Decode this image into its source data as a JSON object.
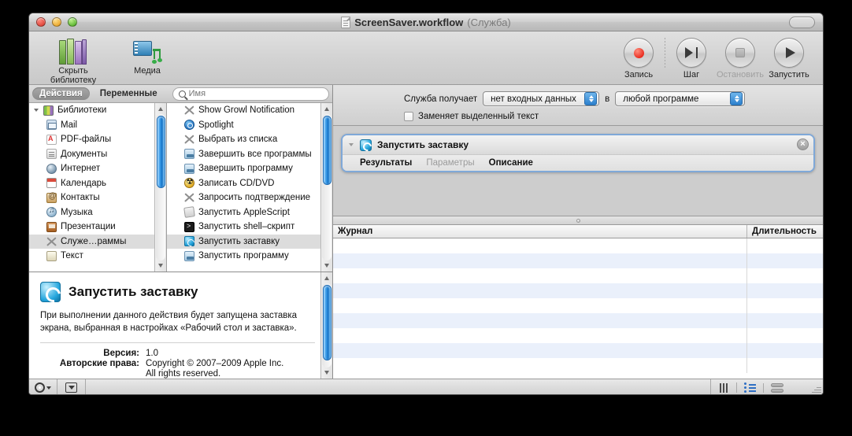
{
  "window": {
    "title": "ScreenSaver.workflow",
    "title_suffix": "(Служба)",
    "doc_icon": "document-icon",
    "toolbar_toggle": "toolbar-toggle-pill"
  },
  "toolbar": {
    "items": [
      {
        "label": "Скрыть библиотеку",
        "icon": "library-books-icon"
      },
      {
        "label": "Медиа",
        "icon": "media-icon"
      }
    ],
    "controls": [
      {
        "label": "Запись",
        "icon": "record-dot-icon",
        "enabled": true
      },
      {
        "label": "Шаг",
        "icon": "step-icon",
        "enabled": true
      },
      {
        "label": "Остановить",
        "icon": "stop-square-icon",
        "enabled": false
      },
      {
        "label": "Запустить",
        "icon": "play-triangle-icon",
        "enabled": true
      }
    ]
  },
  "library": {
    "tabs": [
      {
        "label": "Действия",
        "selected": true
      },
      {
        "label": "Переменные",
        "selected": false
      }
    ],
    "search": {
      "placeholder": "Имя",
      "value": ""
    },
    "tree": [
      {
        "label": "Библиотеки",
        "icon": "libraries-icon",
        "root": true,
        "selected": false
      },
      {
        "label": "Mail",
        "icon": "mail-icon",
        "root": false,
        "selected": false
      },
      {
        "label": "PDF-файлы",
        "icon": "pdf-icon",
        "root": false,
        "selected": false
      },
      {
        "label": "Документы",
        "icon": "documents-icon",
        "root": false,
        "selected": false
      },
      {
        "label": "Интернет",
        "icon": "internet-icon",
        "root": false,
        "selected": false
      },
      {
        "label": "Календарь",
        "icon": "calendar-icon",
        "root": false,
        "selected": false
      },
      {
        "label": "Контакты",
        "icon": "contacts-icon",
        "root": false,
        "selected": false
      },
      {
        "label": "Музыка",
        "icon": "music-icon",
        "root": false,
        "selected": false
      },
      {
        "label": "Презентации",
        "icon": "presentations-icon",
        "root": false,
        "selected": false
      },
      {
        "label": "Служе…раммы",
        "icon": "utilities-icon",
        "root": false,
        "selected": true
      },
      {
        "label": "Текст",
        "icon": "text-icon",
        "root": false,
        "selected": false
      }
    ],
    "actions": [
      {
        "label": "Show Growl Notification",
        "icon": "utilities-icon",
        "selected": false
      },
      {
        "label": "Spotlight",
        "icon": "spotlight-icon",
        "selected": false
      },
      {
        "label": "Выбрать из списка",
        "icon": "utilities-icon",
        "selected": false
      },
      {
        "label": "Завершить все программы",
        "icon": "application-icon",
        "selected": false
      },
      {
        "label": "Завершить программу",
        "icon": "application-icon",
        "selected": false
      },
      {
        "label": "Записать CD/DVD",
        "icon": "burn-icon",
        "selected": false
      },
      {
        "label": "Запросить подтверждение",
        "icon": "utilities-icon",
        "selected": false
      },
      {
        "label": "Запустить AppleScript",
        "icon": "applescript-icon",
        "selected": false
      },
      {
        "label": "Запустить shell–скрипт",
        "icon": "shell-icon",
        "selected": false
      },
      {
        "label": "Запустить заставку",
        "icon": "screensaver-icon",
        "selected": true
      },
      {
        "label": "Запустить программу",
        "icon": "application-icon",
        "selected": false
      }
    ]
  },
  "description": {
    "icon": "screensaver-icon",
    "title": "Запустить заставку",
    "body": "При выполнении данного действия будет запущена заставка экрана, выбранная в настройках «Рабочий стол и заставка».",
    "meta": [
      {
        "key": "Версия:",
        "value": "1.0"
      },
      {
        "key": "Авторские права:",
        "value": "Copyright © 2007–2009 Apple Inc."
      },
      {
        "key": "",
        "value": "All rights reserved."
      }
    ]
  },
  "service_bar": {
    "label_receives": "Служба получает",
    "input_select": {
      "value": "нет входных данных"
    },
    "label_in": "в",
    "app_select": {
      "value": "любой программе"
    },
    "checkbox": {
      "label": "Заменяет выделенный текст",
      "checked": false
    }
  },
  "workflow": {
    "action": {
      "name": "Запустить заставку",
      "icon": "screensaver-icon",
      "disclosure": "disclosure-triangle-icon",
      "close": "×",
      "tabs": [
        {
          "label": "Результаты",
          "dim": false,
          "bold": true
        },
        {
          "label": "Параметры",
          "dim": true,
          "bold": false
        },
        {
          "label": "Описание",
          "dim": false,
          "bold": true
        }
      ]
    }
  },
  "log": {
    "columns": [
      "Журнал",
      "Длительность"
    ],
    "rows": []
  },
  "status_bar": {
    "buttons": [
      {
        "name": "gear-menu",
        "icon": "gear-icon"
      },
      {
        "name": "collapse-button",
        "icon": "box-down-icon"
      }
    ],
    "view_modes": [
      {
        "name": "resize-grip",
        "icon": "vertical-bars-icon"
      },
      {
        "name": "list-view",
        "icon": "list-icon",
        "active": true
      },
      {
        "name": "stack-view",
        "icon": "stack-icon",
        "active": false
      }
    ]
  },
  "colors": {
    "accent_blue": "#2b7fcc",
    "action_border": "#7fa8d8",
    "log_stripe": "#eaf0fb",
    "record_red": "#e8281b"
  }
}
